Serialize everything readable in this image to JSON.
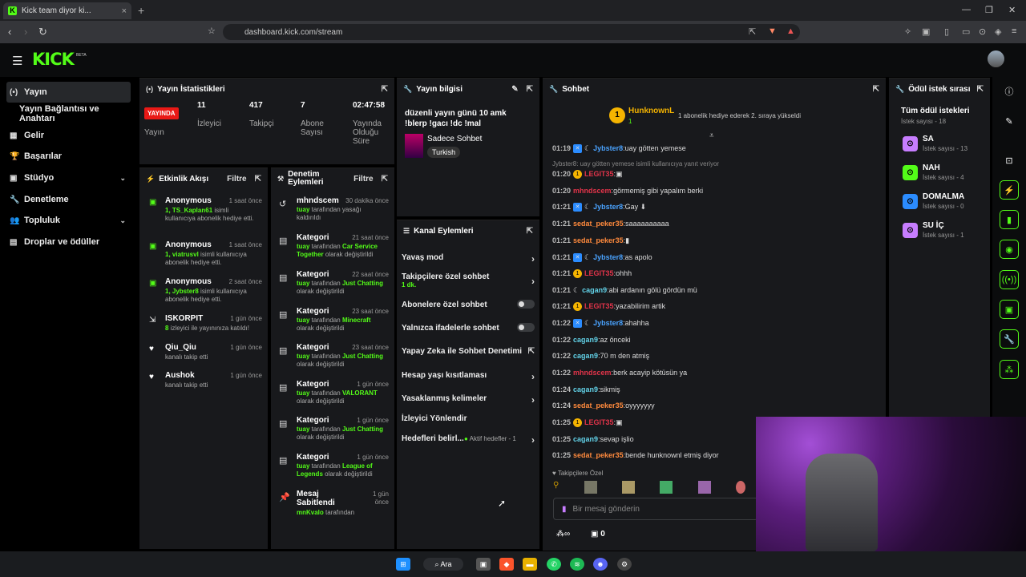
{
  "browser": {
    "tab_title": "Kick team diyor ki...",
    "tab_close": "×",
    "new_tab": "+",
    "url": "dashboard.kick.com/stream"
  },
  "app": {
    "logo": "KICK",
    "beta": "BETA"
  },
  "sidebar": {
    "items": [
      {
        "label": "Yayın",
        "icon": "(•)"
      },
      {
        "label": "Yayın Bağlantısı ve Anahtarı"
      },
      {
        "label": "Gelir",
        "icon": "▦"
      },
      {
        "label": "Başarılar",
        "icon": "🏆"
      },
      {
        "label": "Stüdyo",
        "icon": "▣"
      },
      {
        "label": "Denetleme",
        "icon": "🔧"
      },
      {
        "label": "Topluluk",
        "icon": "👥"
      },
      {
        "label": "Droplar ve ödüller",
        "icon": "▤"
      }
    ]
  },
  "stats": {
    "title": "Yayın İstatistikleri",
    "live_badge": "YAYINDA",
    "live_label": "Yayın",
    "viewers": "11",
    "viewers_label": "İzleyici",
    "followers": "417",
    "followers_label": "Takipçi",
    "subs": "7",
    "subs_label": "Abone Sayısı",
    "duration": "02:47:58",
    "duration_label": "Yayında Olduğu Süre"
  },
  "feed": {
    "title": "Etkinlik Akışı",
    "filter": "Filtre",
    "items": [
      {
        "name": "Anonymous",
        "time": "1 saat önce",
        "hl": "1, TS_Kaplan61",
        "rest": " isimli kullanıcıya abonelik hediye etti."
      },
      {
        "name": "Anonymous",
        "time": "1 saat önce",
        "hl": "1, viatrusvl",
        "rest": " isimli kullanıcıya abonelik hediye etti."
      },
      {
        "name": "Anonymous",
        "time": "2 saat önce",
        "hl": "1, Jybster8",
        "rest": " isimli kullanıcıya abonelik hediye etti."
      },
      {
        "name": "ISKORPIT",
        "time": "1 gün önce",
        "hl": "8",
        "rest": " izleyici ile yayınınıza katıldı!"
      },
      {
        "name": "Qiu_Qiu",
        "time": "1 gün önce",
        "hl": "",
        "rest": "kanalı takip etti"
      },
      {
        "name": "Aushok",
        "time": "1 gün önce",
        "hl": "",
        "rest": "kanalı takip etti"
      }
    ]
  },
  "modlog": {
    "title": "Denetim Eylemleri",
    "filter": "Filtre",
    "items": [
      {
        "title": "mhndscem",
        "time": "30 dakika önce",
        "pre": "tuay",
        "mid": " tarafından yasağı kaldırıldı",
        "hl": "",
        "post": ""
      },
      {
        "title": "Kategori",
        "time": "21 saat önce",
        "pre": "tuay",
        "mid": " tarafından ",
        "hl": "Car Service Together",
        "post": " olarak değiştirildi"
      },
      {
        "title": "Kategori",
        "time": "22 saat önce",
        "pre": "tuay",
        "mid": " tarafından ",
        "hl": "Just Chatting",
        "post": " olarak değiştirildi"
      },
      {
        "title": "Kategori",
        "time": "23 saat önce",
        "pre": "tuay",
        "mid": " tarafından ",
        "hl": "Minecraft",
        "post": " olarak değiştirildi"
      },
      {
        "title": "Kategori",
        "time": "23 saat önce",
        "pre": "tuay",
        "mid": " tarafından ",
        "hl": "Just Chatting",
        "post": " olarak değiştirildi"
      },
      {
        "title": "Kategori",
        "time": "1 gün önce",
        "pre": "tuay",
        "mid": " tarafından ",
        "hl": "VALORANT",
        "post": " olarak değiştirildi"
      },
      {
        "title": "Kategori",
        "time": "1 gün önce",
        "pre": "tuay",
        "mid": " tarafından ",
        "hl": "Just Chatting",
        "post": " olarak değiştirildi"
      },
      {
        "title": "Kategori",
        "time": "1 gün önce",
        "pre": "tuay",
        "mid": " tarafından ",
        "hl": "League of Legends",
        "post": " olarak değiştirildi"
      },
      {
        "title": "Mesaj Sabitlendi",
        "time": "1 gün önce",
        "pre": "mnKvalo",
        "mid": " tarafından",
        "hl": "",
        "post": ""
      }
    ]
  },
  "info": {
    "title": "Yayın bilgisi",
    "stream_title": "düzenli yayın günü 10 amk !blerp !gacı !dc !mal",
    "category": "Sadece Sohbet",
    "language": "Turkish"
  },
  "channel": {
    "title": "Kanal Eylemleri",
    "actions": [
      {
        "label": "Yavaş mod",
        "sub": "",
        "kind": "arrow"
      },
      {
        "label": "Takipçilere özel sohbet",
        "sub": "1 dk.",
        "kind": "arrow"
      },
      {
        "label": "Abonelere özel sohbet",
        "sub": "",
        "kind": "toggle"
      },
      {
        "label": "Yalnızca ifadelerle sohbet",
        "sub": "",
        "kind": "toggle"
      },
      {
        "label": "Yapay Zeka ile Sohbet Denetimi",
        "sub": "",
        "kind": "ext"
      },
      {
        "label": "Hesap yaşı kısıtlaması",
        "sub": "",
        "kind": "arrow"
      },
      {
        "label": "Yasaklanmış kelimeler",
        "sub": "",
        "kind": "arrow"
      },
      {
        "label": "İzleyici Yönlendir",
        "sub": "",
        "kind": "none"
      },
      {
        "label": "Hedefleri belirl...",
        "sub": "Aktif hedefler - 1",
        "kind": "arrow"
      }
    ]
  },
  "chat": {
    "title": "Sohbet",
    "pinned_user": "HunknownL",
    "pinned_badge": "1",
    "pinned_count": "1",
    "pinned_text": "1 abonelik hediye ederek 2. sıraya yükseldi",
    "reply_text": "Jybster8: uay götten yemese isimli kullanıcıya yanıt veriyor",
    "messages": [
      {
        "t": "01:19",
        "u": "Jybster8",
        "c": "#4aa3ff",
        "m": "uay götten yemese",
        "b": "blue"
      },
      {
        "t": "01:20",
        "u": "LEGIT35",
        "c": "#e3344a",
        "m": "▣",
        "b": "gold"
      },
      {
        "t": "01:20",
        "u": "mhndscem",
        "c": "#e3344a",
        "m": "görmemiş gibi yapalım berki",
        "b": ""
      },
      {
        "t": "01:21",
        "u": "Jybster8",
        "c": "#4aa3ff",
        "m": "Gay ⬇",
        "b": "blue"
      },
      {
        "t": "01:21",
        "u": "sedat_peker35",
        "c": "#ff8a3d",
        "m": "saaaaaaaaaa",
        "b": ""
      },
      {
        "t": "01:21",
        "u": "sedat_peker35",
        "c": "#ff8a3d",
        "m": "▮",
        "b": ""
      },
      {
        "t": "01:21",
        "u": "Jybster8",
        "c": "#4aa3ff",
        "m": "as apolo",
        "b": "blue"
      },
      {
        "t": "01:21",
        "u": "LEGIT35",
        "c": "#e3344a",
        "m": "ohhh",
        "b": "gold"
      },
      {
        "t": "01:21",
        "u": "cagan9",
        "c": "#62d2e8",
        "m": "abi ardanın gölü gördün mü",
        "b": "moon"
      },
      {
        "t": "01:21",
        "u": "LEGIT35",
        "c": "#e3344a",
        "m": "yazabilirim artik",
        "b": "gold"
      },
      {
        "t": "01:22",
        "u": "Jybster8",
        "c": "#4aa3ff",
        "m": "ahahha",
        "b": "blue"
      },
      {
        "t": "01:22",
        "u": "cagan9",
        "c": "#62d2e8",
        "m": "az önceki",
        "b": ""
      },
      {
        "t": "01:22",
        "u": "cagan9",
        "c": "#62d2e8",
        "m": "70 m den atmiş",
        "b": ""
      },
      {
        "t": "01:22",
        "u": "mhndscem",
        "c": "#e3344a",
        "m": "berk acayip kötüsün ya",
        "b": ""
      },
      {
        "t": "01:24",
        "u": "cagan9",
        "c": "#62d2e8",
        "m": "sikmiş",
        "b": ""
      },
      {
        "t": "01:24",
        "u": "sedat_peker35",
        "c": "#ff8a3d",
        "m": "oyyyyyyy",
        "b": ""
      },
      {
        "t": "01:25",
        "u": "LEGIT35",
        "c": "#e3344a",
        "m": "▣",
        "b": "gold"
      },
      {
        "t": "01:25",
        "u": "cagan9",
        "c": "#62d2e8",
        "m": "sevap işlio",
        "b": ""
      },
      {
        "t": "01:25",
        "u": "sedat_peker35",
        "c": "#ff8a3d",
        "m": "bende hunknownl etmiş diyor",
        "b": ""
      }
    ],
    "followers_only": "Takipçilere Özel",
    "placeholder": "Bir mesaj gönderin",
    "points": "0"
  },
  "rewards": {
    "title": "Ödül istek sırası",
    "all": "Tüm ödül istekleri",
    "all_count": "İstek sayısı - 18",
    "items": [
      {
        "name": "SA",
        "count": "İstek sayısı - 13",
        "color": "#c77dff"
      },
      {
        "name": "NAH",
        "count": "İstek sayısı - 4",
        "color": "#53fc18"
      },
      {
        "name": "DOMALMA",
        "count": "İstek sayısı - 0",
        "color": "#2b8cff"
      },
      {
        "name": "SU İÇ",
        "count": "İstek sayısı - 1",
        "color": "#c77dff"
      }
    ]
  },
  "taskbar": {
    "search": "Ara"
  }
}
